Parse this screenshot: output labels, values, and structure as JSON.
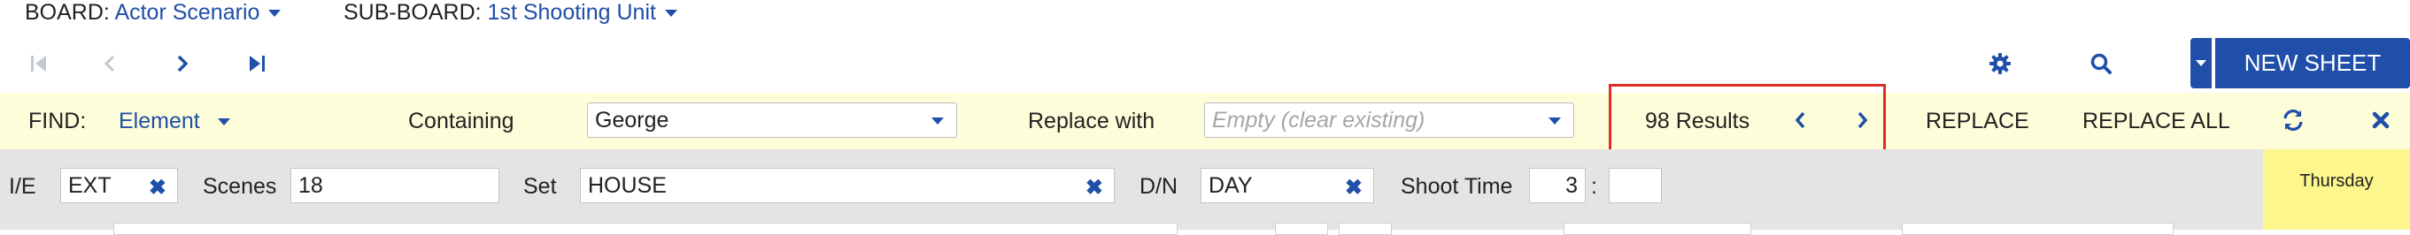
{
  "header": {
    "board_label": "BOARD:",
    "board_value": "Actor Scenario",
    "subboard_label": "SUB-BOARD:",
    "subboard_value": "1st Shooting Unit"
  },
  "toolbar": {
    "new_sheet_label": "NEW SHEET"
  },
  "find": {
    "find_label": "FIND:",
    "find_type": "Element",
    "containing_label": "Containing",
    "containing_value": "George",
    "replace_with_label": "Replace with",
    "replace_placeholder": "Empty (clear existing)",
    "results_text": "98 Results",
    "replace_label": "REPLACE",
    "replace_all_label": "REPLACE ALL"
  },
  "scene": {
    "ie_label": "I/E",
    "ie_value": "EXT",
    "scenes_label": "Scenes",
    "scenes_value": "18",
    "set_label": "Set",
    "set_value": "HOUSE",
    "dn_label": "D/N",
    "dn_value": "DAY",
    "shoot_time_label": "Shoot Time",
    "shoot_time_hours": "3",
    "shoot_time_sep": ":",
    "shoot_time_minutes": ""
  },
  "calendar": {
    "day_label": "Thursday"
  },
  "colors": {
    "accent": "#1f4fa8",
    "find_bar_bg": "#fefdd9",
    "highlight_border": "#e02e24",
    "scene_row_bg": "#e4e4e4",
    "day_bg": "#fdf68c"
  },
  "icons": [
    "first-page-icon",
    "previous-icon",
    "next-icon",
    "last-page-icon",
    "gear-icon",
    "search-icon",
    "chevron-left-icon",
    "chevron-right-icon",
    "refresh-icon",
    "close-icon"
  ]
}
